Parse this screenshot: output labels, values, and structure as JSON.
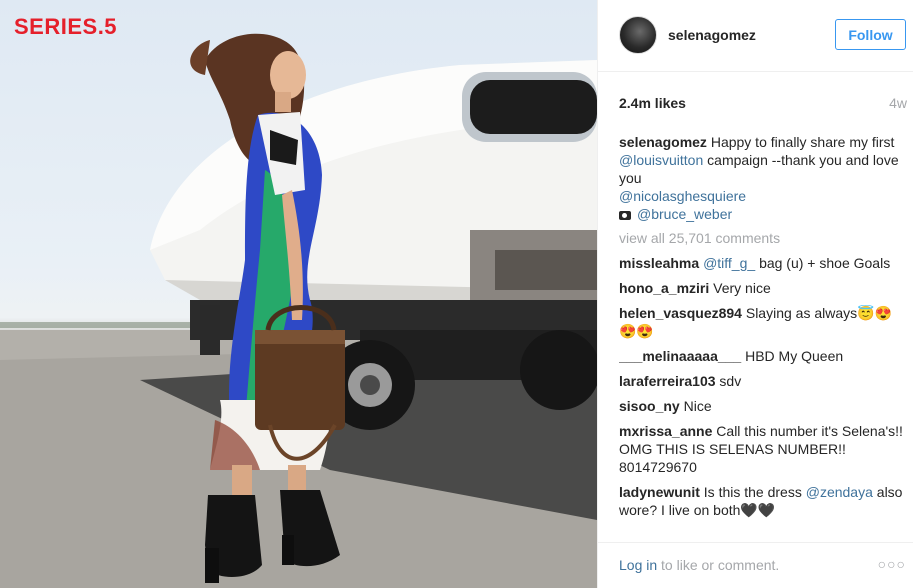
{
  "photo": {
    "watermark": "SERIES.5"
  },
  "header": {
    "username": "selenagomez",
    "follow_label": "Follow"
  },
  "stats": {
    "likes": "2.4m likes",
    "age": "4w"
  },
  "caption": {
    "user": "selenagomez",
    "text": "Happy to finally share my first",
    "mention1": "@louisvuitton",
    "text2": "campaign --thank you and love you",
    "mention2": "@nicolasghesquiere",
    "mention3": "@bruce_weber"
  },
  "view_all": "view all 25,701 comments",
  "comments": [
    {
      "user": "missleahma",
      "mention": "@tiff_g_",
      "text": "bag (u) + shoe Goals"
    },
    {
      "user": "hono_a_mziri",
      "mention": "",
      "text": "Very nice"
    },
    {
      "user": "helen_vasquez894",
      "mention": "",
      "text": "Slaying as always😇😍😍😍"
    },
    {
      "user": "___melinaaaaa___",
      "mention": "",
      "text": "HBD My Queen"
    },
    {
      "user": "laraferreira103",
      "mention": "",
      "text": "sdv"
    },
    {
      "user": "sisoo_ny",
      "mention": "",
      "text": "Nice"
    },
    {
      "user": "mxrissa_anne",
      "mention": "",
      "text": "Call this number it's Selena's!! OMG THIS IS SELENAS NUMBER!! 8014729670"
    },
    {
      "user": "ladynewunit",
      "mention": "",
      "text": "Is this the dress",
      "mention_after": "@zendaya",
      "text_after": "also wore? I live on both🖤🖤"
    }
  ],
  "footer": {
    "login_link": "Log in",
    "login_text": "to like or comment.",
    "more_icon": "more-options-icon"
  }
}
